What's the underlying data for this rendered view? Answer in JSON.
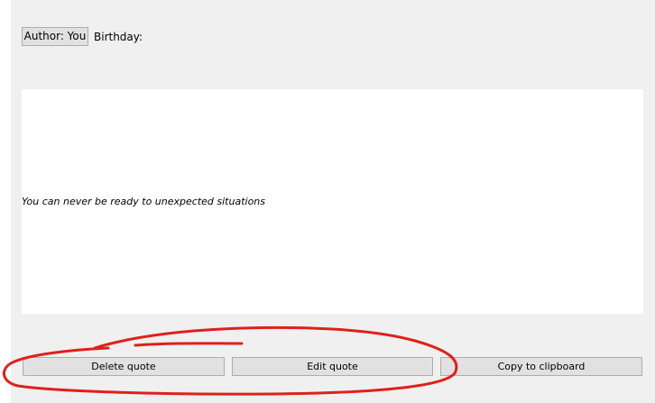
{
  "header": {
    "author_button_label": "Author: You",
    "birthday_label": "Birthday:"
  },
  "quote": {
    "text": "You can never be ready to unexpected situations"
  },
  "actions": {
    "delete_label": "Delete quote",
    "edit_label": "Edit quote",
    "copy_label": "Copy to clipboard"
  },
  "annotation": {
    "color": "#e0201b"
  }
}
